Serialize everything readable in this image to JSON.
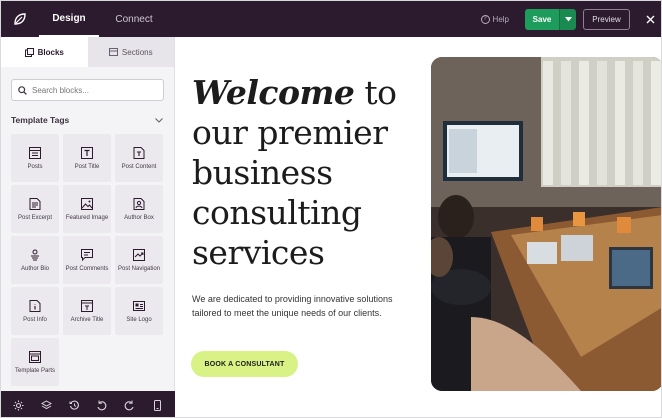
{
  "topbar": {
    "tabs": [
      {
        "label": "Design",
        "active": true
      },
      {
        "label": "Connect",
        "active": false
      }
    ],
    "help_label": "Help",
    "save_label": "Save",
    "preview_label": "Preview",
    "accent_color": "#1e9c5b",
    "bar_color": "#2c1a2e"
  },
  "sidebar": {
    "tabs": [
      {
        "label": "Blocks",
        "icon": "blocks-icon",
        "active": true
      },
      {
        "label": "Sections",
        "icon": "sections-icon",
        "active": false
      }
    ],
    "search": {
      "placeholder": "Search blocks...",
      "value": ""
    },
    "section_title": "Template Tags",
    "blocks": [
      {
        "label": "Posts",
        "icon": "posts-icon"
      },
      {
        "label": "Post Title",
        "icon": "post-title-icon"
      },
      {
        "label": "Post Content",
        "icon": "post-content-icon"
      },
      {
        "label": "Post Excerpt",
        "icon": "post-excerpt-icon"
      },
      {
        "label": "Featured Image",
        "icon": "featured-image-icon"
      },
      {
        "label": "Author Box",
        "icon": "author-box-icon"
      },
      {
        "label": "Author Bio",
        "icon": "author-bio-icon"
      },
      {
        "label": "Post Comments",
        "icon": "post-comments-icon"
      },
      {
        "label": "Post Navigation",
        "icon": "post-navigation-icon"
      },
      {
        "label": "Post Info",
        "icon": "post-info-icon"
      },
      {
        "label": "Archive Title",
        "icon": "archive-title-icon"
      },
      {
        "label": "Site Logo",
        "icon": "site-logo-icon"
      },
      {
        "label": "Template Parts",
        "icon": "template-parts-icon"
      }
    ],
    "bottom_icons": [
      "settings-icon",
      "layers-icon",
      "history-icon",
      "undo-icon",
      "redo-icon",
      "mobile-preview-icon"
    ]
  },
  "canvas": {
    "headline_emphasis": "Welcome",
    "headline_rest": " to our premier business consulting services",
    "paragraph": "We are dedicated to providing innovative solutions tailored to meet the unique needs of our clients.",
    "cta_label": "BOOK A CONSULTANT",
    "cta_color": "#d9f285"
  }
}
